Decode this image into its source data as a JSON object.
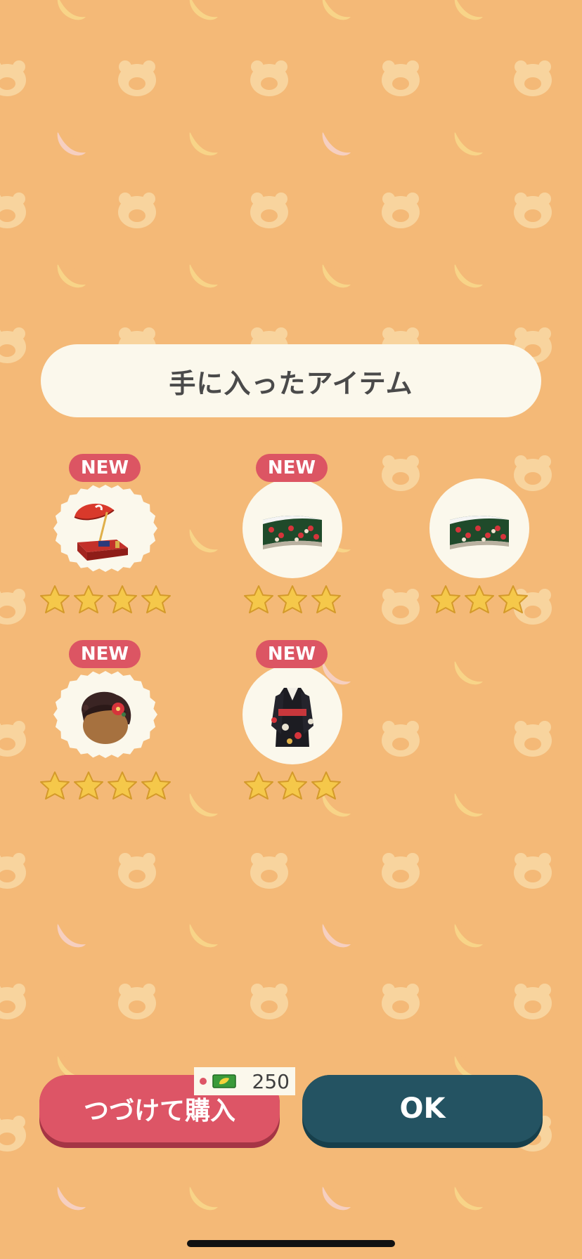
{
  "title": "手に入ったアイテム",
  "items": [
    {
      "badge": "NEW",
      "name": "parasol-stand",
      "rarity": 4,
      "frame": "scalloped"
    },
    {
      "badge": "NEW",
      "name": "camellia-hedge",
      "rarity": 3,
      "frame": "circle"
    },
    {
      "badge": "",
      "name": "camellia-hedge",
      "rarity": 3,
      "frame": "circle"
    },
    {
      "badge": "NEW",
      "name": "camellia-hairstyle",
      "rarity": 4,
      "frame": "scalloped"
    },
    {
      "badge": "NEW",
      "name": "black-furisode",
      "rarity": 3,
      "frame": "circle"
    }
  ],
  "buttons": {
    "continue_label": "つづけて購入",
    "ok_label": "OK"
  },
  "price": {
    "amount": "250",
    "icon": "leaf-ticket-icon"
  },
  "colors": {
    "background": "#f4b977",
    "accent_red": "#dd5566",
    "ok_teal": "#245362",
    "cream": "#fbf8ec",
    "star_gold": "#f5c84a"
  }
}
